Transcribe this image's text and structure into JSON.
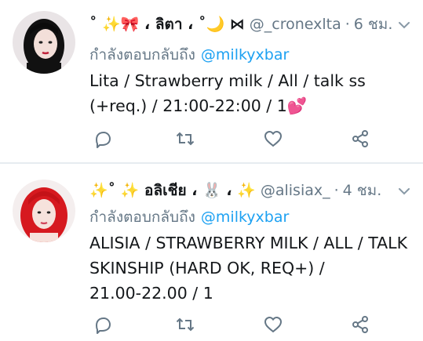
{
  "colors": {
    "accent": "#1da1f2",
    "secondary_text": "#657786",
    "primary_text": "#14171a",
    "divider": "#e6ecf0"
  },
  "tweets": [
    {
      "display_name": "˚ ✨🎀 ، ลิตา ، ˚🌙 ⋈",
      "handle": "@_cronexlta",
      "separator": "·",
      "time": "6 ชม.",
      "reply_prefix": "กำลังตอบกลับถึง",
      "reply_to": "@milkyxbar",
      "text": "Lita / Strawberry milk / All / talk ss\n(+req.) / 21:00-22:00 / 1💕",
      "icons": [
        "reply-icon",
        "retweet-icon",
        "like-icon",
        "share-icon"
      ]
    },
    {
      "display_name": "✨˚ ✨ อลิเชีย ، 🐰 ، ✨",
      "handle": "@alisiax_",
      "separator": "·",
      "time": "4 ชม.",
      "reply_prefix": "กำลังตอบกลับถึง",
      "reply_to": "@milkyxbar",
      "text": "ALISIA / STRAWBERRY MILK / ALL / TALK\nSKINSHIP (HARD OK, REQ+) /\n21.00-22.00 / 1",
      "icons": [
        "reply-icon",
        "retweet-icon",
        "like-icon",
        "share-icon"
      ]
    }
  ]
}
